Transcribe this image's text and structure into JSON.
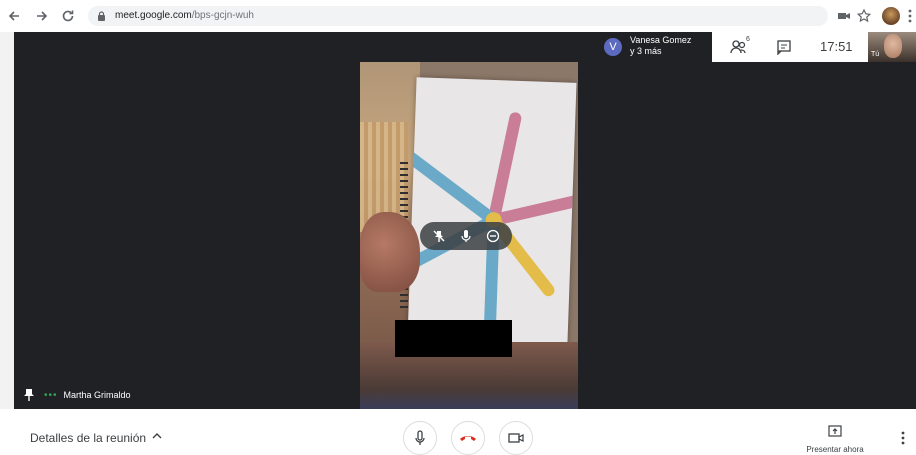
{
  "browser": {
    "url_host": "meet.google.com",
    "url_path": "/bps-gcjn-wuh",
    "icons": [
      "back-arrow-icon",
      "forward-arrow-icon",
      "reload-icon",
      "lock-icon",
      "camera-icon",
      "star-icon",
      "profile-avatar-icon",
      "menu-kebab-icon"
    ]
  },
  "meeting": {
    "participants_badge": "V",
    "participants_name": "Vanesa Gomez",
    "participants_more": "y 3 más",
    "people_count": "6",
    "time": "17:51",
    "self_label": "Tú",
    "speaker_name": "Martha Grimaldo"
  },
  "bottom": {
    "details_label": "Detalles de la reunión",
    "present_label": "Presentar ahora"
  },
  "colors": {
    "stage_bg": "#202124",
    "hangup_red": "#d93025",
    "badge": "#5c6bc0",
    "speaking_dots": "#37a05a"
  }
}
